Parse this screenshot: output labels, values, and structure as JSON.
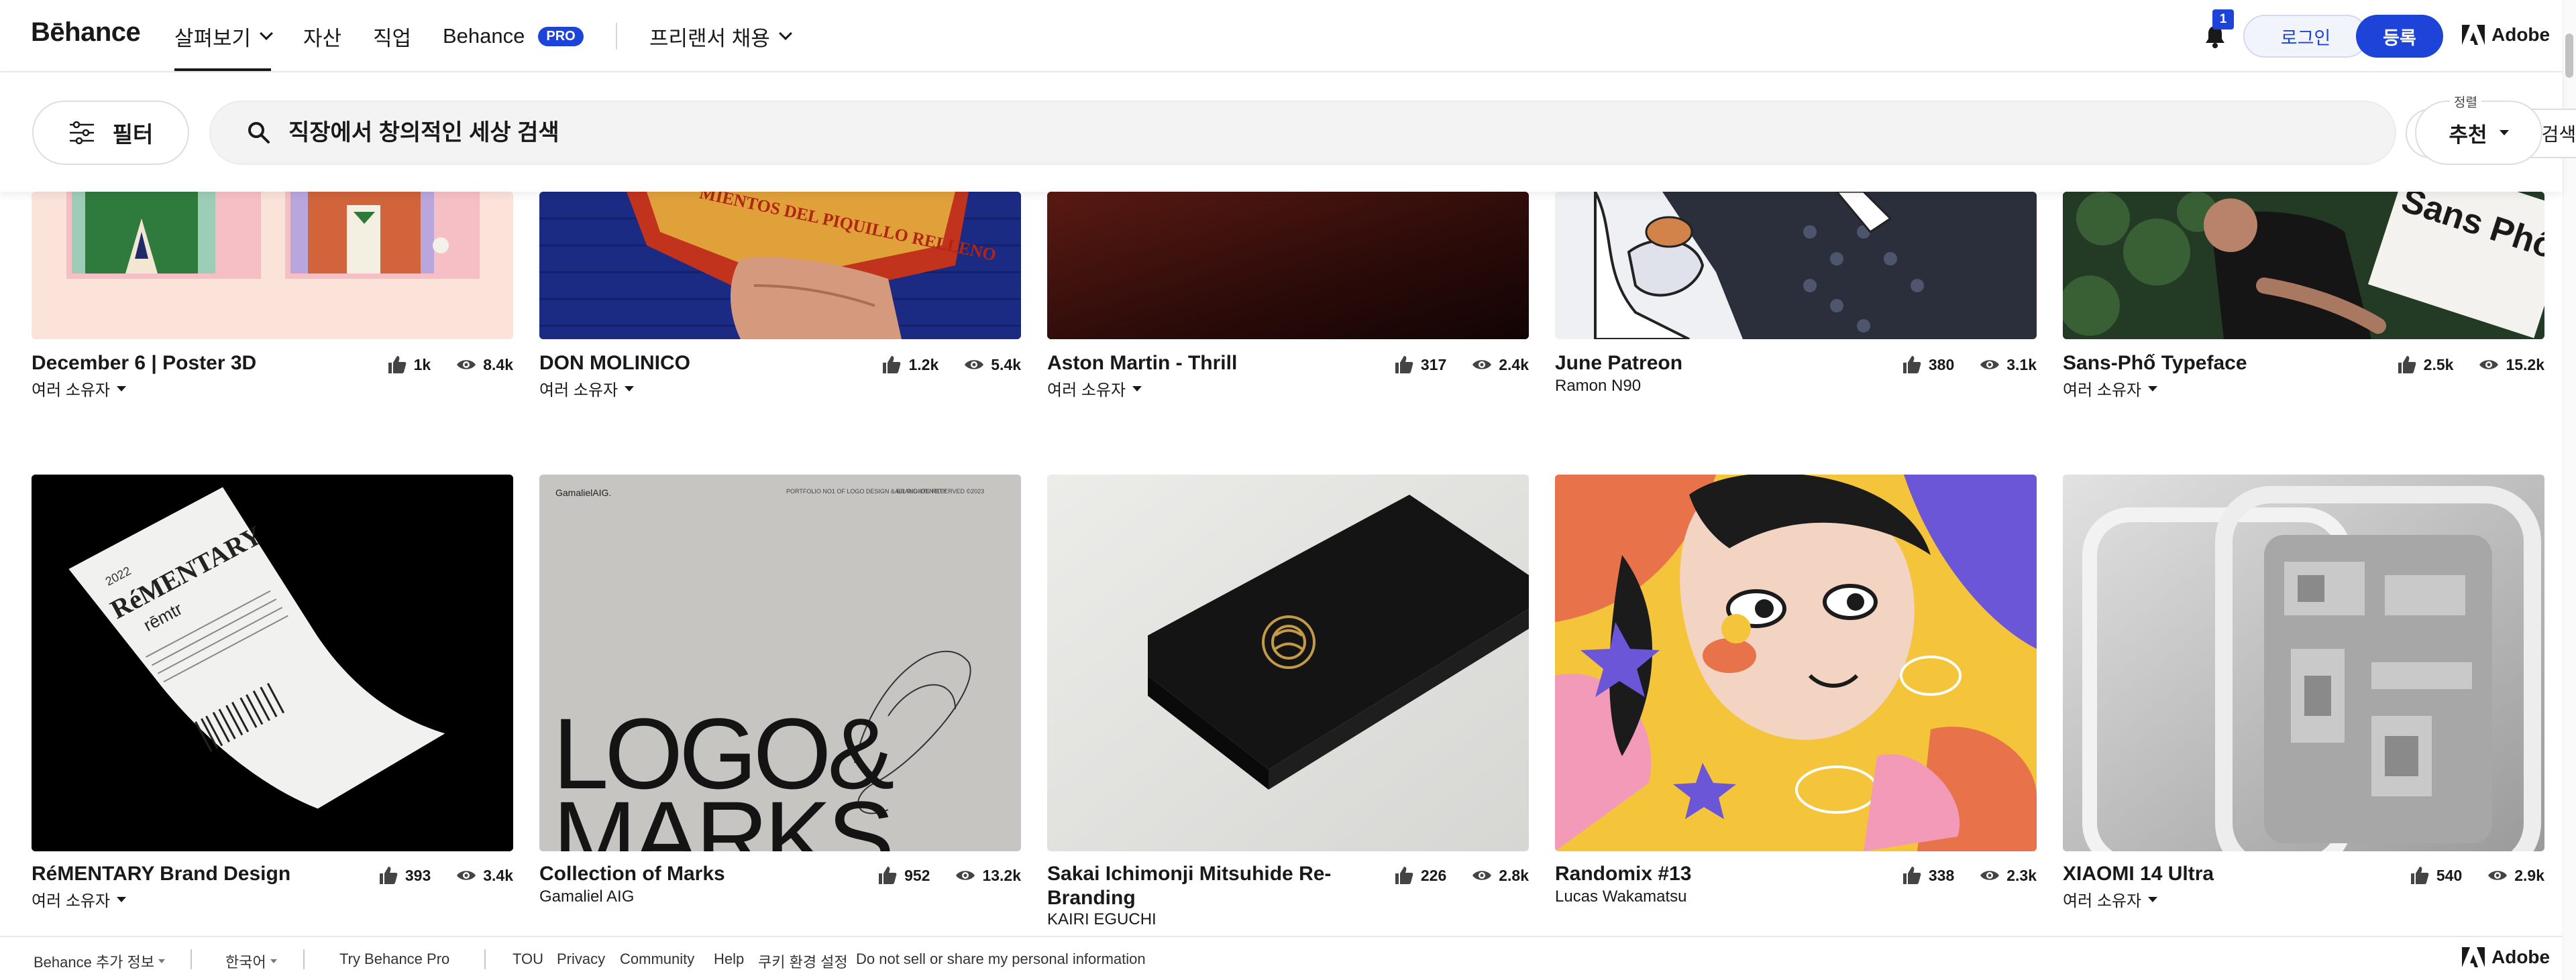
{
  "nav": {
    "logo": "Bēhance",
    "explore": "살펴보기",
    "assets": "자산",
    "jobs": "직업",
    "behance": "Behance",
    "pro_badge": "PRO",
    "hire": "프리랜서 채용",
    "notification_count": "1",
    "login": "로그인",
    "signup": "등록",
    "adobe": "Adobe"
  },
  "filterbar": {
    "filter_label": "필터",
    "search_placeholder": "직장에서 창의적인 세상 검색",
    "image_search": "이미지로 검색",
    "sort_label": "정렬",
    "sort_value": "추천"
  },
  "projects": [
    {
      "title": "December 6 | Poster 3D",
      "owner": "여러 소유자",
      "owner_menu": true,
      "likes": "1k",
      "views": "8.4k"
    },
    {
      "title": "DON MOLINICO",
      "owner": "여러 소유자",
      "owner_menu": true,
      "likes": "1.2k",
      "views": "5.4k"
    },
    {
      "title": "Aston Martin - Thrill",
      "owner": "여러 소유자",
      "owner_menu": true,
      "likes": "317",
      "views": "2.4k"
    },
    {
      "title": "June Patreon",
      "owner": "Ramon N90",
      "owner_menu": false,
      "likes": "380",
      "views": "3.1k"
    },
    {
      "title": "Sans-Phố Typeface",
      "owner": "여러 소유자",
      "owner_menu": true,
      "likes": "2.5k",
      "views": "15.2k"
    },
    {
      "title": "RéMENTARY Brand Design",
      "owner": "여러 소유자",
      "owner_menu": true,
      "likes": "393",
      "views": "3.4k"
    },
    {
      "title": "Collection of Marks",
      "owner": "Gamaliel AIG",
      "owner_menu": false,
      "likes": "952",
      "views": "13.2k"
    },
    {
      "title": "Sakai Ichimonji Mitsuhide Re-Branding",
      "owner": "KAIRI EGUCHI",
      "owner_menu": false,
      "likes": "226",
      "views": "2.8k"
    },
    {
      "title": "Randomix #13",
      "owner": "Lucas Wakamatsu",
      "owner_menu": false,
      "likes": "338",
      "views": "2.3k"
    },
    {
      "title": "XIAOMI 14 Ultra",
      "owner": "여러 소유자",
      "owner_menu": true,
      "likes": "540",
      "views": "2.9k"
    }
  ],
  "artwork_text": {
    "don_molinico_label": "MIENTOS DEL PIQUILLO RELLENO",
    "sans_pho_sign": "Sans Phố",
    "receipt_brand": "RéMENTARY",
    "receipt_sub": "rēmtr",
    "receipt_year": "2022",
    "gamaliel_header": "GamalielAIG.",
    "gamaliel_portfolio": "PORTFOLIO NO1 OF LOGO DESIGN & BRAND IDENTITY",
    "gamaliel_rights": "ALL RIGHTS RESERVED ©2023",
    "logo_line1": "LOGO&",
    "logo_line2": "MARKS"
  },
  "footer": {
    "more_info": "Behance 추가 정보",
    "language": "한국어",
    "try_pro": "Try Behance Pro",
    "tou": "TOU",
    "privacy": "Privacy",
    "community": "Community",
    "help": "Help",
    "cookies": "쿠키 환경 설정",
    "do_not_sell": "Do not sell or share my personal information",
    "adobe": "Adobe"
  },
  "colors": {
    "brand_blue": "#1d43d8",
    "text": "#191919"
  }
}
